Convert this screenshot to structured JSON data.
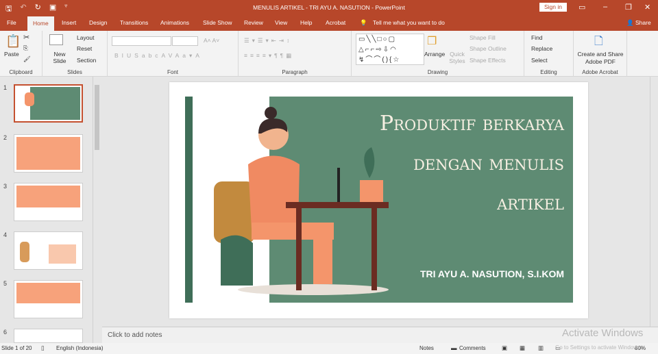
{
  "window": {
    "title": "MENULIS ARTIKEL - TRI AYU A. NASUTION  -  PowerPoint",
    "sign_in": "Sign in"
  },
  "tabs": [
    "File",
    "Home",
    "Insert",
    "Design",
    "Transitions",
    "Animations",
    "Slide Show",
    "Review",
    "View",
    "Help",
    "Acrobat"
  ],
  "tell_me": "Tell me what you want to do",
  "share": "Share",
  "ribbon": {
    "clipboard": {
      "paste": "Paste",
      "label": "Clipboard"
    },
    "slides": {
      "new_slide": "New Slide",
      "layout": "Layout",
      "reset": "Reset",
      "section": "Section",
      "label": "Slides"
    },
    "font": {
      "label": "Font"
    },
    "paragraph": {
      "label": "Paragraph"
    },
    "drawing": {
      "arrange": "Arrange",
      "quick_styles": "Quick Styles",
      "shape_fill": "Shape Fill",
      "shape_outline": "Shape Outline",
      "shape_effects": "Shape Effects",
      "label": "Drawing"
    },
    "editing": {
      "find": "Find",
      "replace": "Replace",
      "select": "Select",
      "label": "Editing"
    },
    "acrobat": {
      "create": "Create and Share Adobe PDF",
      "label": "Adobe Acrobat"
    }
  },
  "thumbnails": [
    "1",
    "2",
    "3",
    "4",
    "5",
    "6"
  ],
  "slide": {
    "title_lines": [
      "Produktif berkarya",
      "dengan menulis",
      "artikel"
    ],
    "author": "TRI AYU A. NASUTION, S.I.KOM",
    "colors": {
      "green": "#5e8b73",
      "dark_green": "#3f6e58",
      "orange": "#f4956b"
    }
  },
  "notes_placeholder": "Click to add notes",
  "status": {
    "slide": "Slide 1 of 20",
    "language": "English (Indonesia)",
    "notes": "Notes",
    "comments": "Comments",
    "zoom": "80%"
  },
  "watermark": {
    "line1": "Activate Windows",
    "line2": "Go to Settings to activate Windows."
  }
}
